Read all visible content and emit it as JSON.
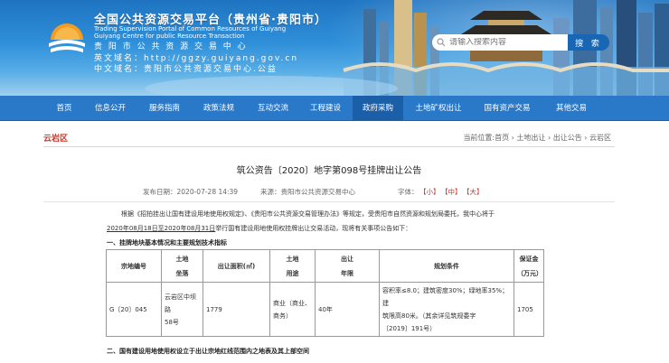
{
  "header": {
    "title_cn": "全国公共资源交易平台（贵州省·贵阳市）",
    "title_en_1": "Trading Supervision Portal of Common Resources of Guiyang",
    "title_en_2": "Guiyang Centre for public Resource Transaction",
    "info_cn_name": "贵 阳 市 公 共 资 源 交 易 中 心",
    "info_en_domain": "英文域名：http://ggzy.guiyang.gov.cn",
    "info_cn_domain": "中文域名：贵阳市公共资源交易中心.公益",
    "search_placeholder": "请输入搜索内容",
    "search_button": "搜 索"
  },
  "nav": {
    "items": [
      "首页",
      "信息公开",
      "服务指南",
      "政策法规",
      "互动交流",
      "工程建设",
      "政府采购",
      "土地矿权出让",
      "国有资产交易",
      "其他交易"
    ],
    "active_index": 6
  },
  "crumb": {
    "section": "云岩区",
    "path": "当前位置:首页 › 土地出让 › 出让公告 › 云岩区"
  },
  "article": {
    "title": "筑公资告〔2020〕地字第098号挂牌出让公告",
    "publish_date": "发布日期：2020-07-28 14:39",
    "source": "来源：贵阳市公共资源交易中心",
    "font_label": "字体：",
    "font_small": "【小】",
    "font_mid": "【中】",
    "font_big": "【大】",
    "para1": "根据《招拍挂出让国有建设用地使用权规定》、《贵阳市公共资源交易管理办法》等规定，受贵阳市自然资源和规划局委托，我中心将于",
    "para2_date": "2020年08月18日至2020年08月31日",
    "para2_rest": "举行国有建设用地使用权挂牌出让交易活动，现将有关事项公告如下：",
    "heading1": "一、挂牌地块基本情况和主要规划技术指标",
    "heading2": "二、国有建设用地使用权设立于出让宗地红线范围内之地表及其上部空间"
  },
  "table": {
    "headers": {
      "h1": "宗地编号",
      "h2": "土地\n坐落",
      "h3": "出让面积(㎡)",
      "h4": "土地\n用途",
      "h5": "出让\n年限",
      "h6": "规划条件",
      "h7": "保证金\n（万元）"
    },
    "row": {
      "id": "G〔20〕045",
      "location": "云岩区中坝路\n58号",
      "area": "1779",
      "use": "商业（商业、\n商务）",
      "term": "40年",
      "conditions": "容积率≤8.0；建筑密度30%；绿地率35%；建\n筑限高80米。（其余详见筑规委字\n〔2019〕191号）",
      "deposit": "1705"
    }
  },
  "colors": {
    "nav_bg": "#2a78c8",
    "nav_active": "#1b5fa8",
    "accent_red": "#c0392b"
  }
}
